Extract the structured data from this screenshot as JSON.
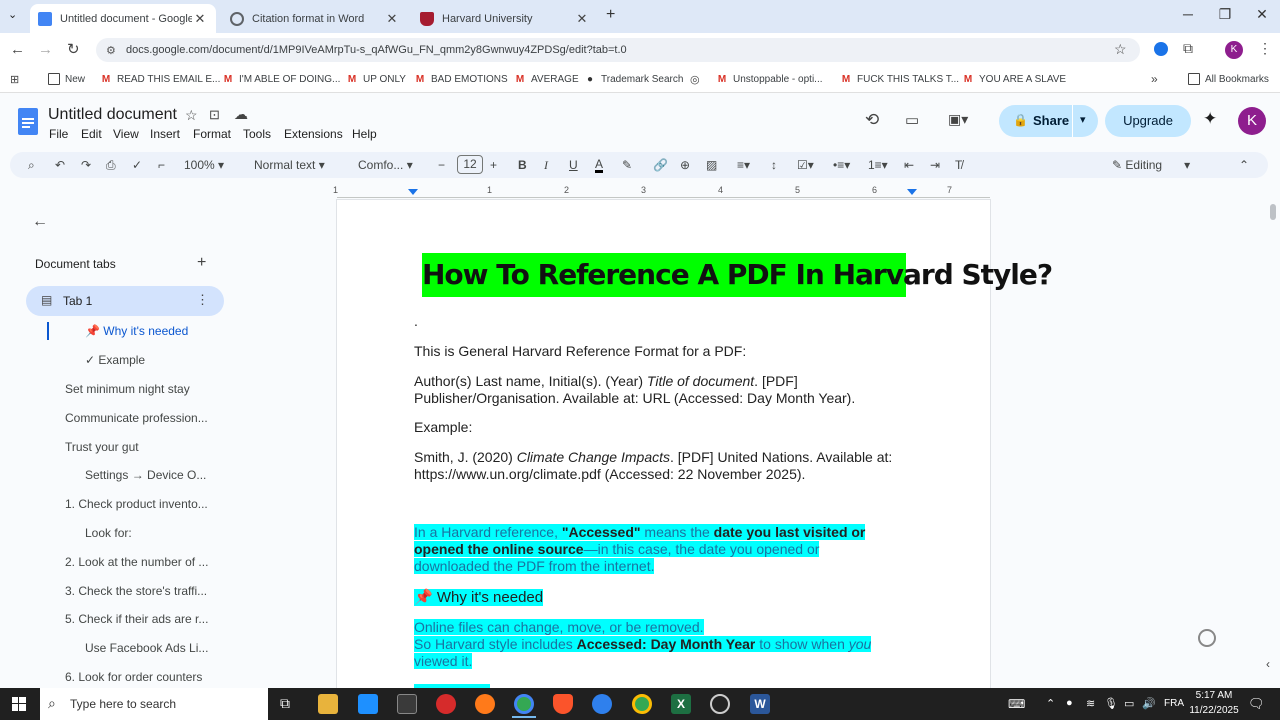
{
  "browser": {
    "tabs": [
      {
        "label": "Untitled document - Google Docs",
        "favicon_color": "#4285f4"
      },
      {
        "label": "Citation format in Word",
        "favicon_color": "#5f6368"
      },
      {
        "label": "Harvard University",
        "favicon_color": "#a51c30"
      }
    ],
    "url": "docs.google.com/document/d/1MP9IVeAMrpTu-s_qAfWGu_FN_qmm2y8Gwnwuy4ZPDSg/edit?tab=t.0",
    "profile_initial": "K"
  },
  "bookmarks": [
    {
      "label": "New",
      "icon": "folder-icon"
    },
    {
      "label": "READ THIS EMAIL E...",
      "icon": "gmail-icon"
    },
    {
      "label": "I'M ABLE OF DOING...",
      "icon": "gmail-icon"
    },
    {
      "label": "UP ONLY",
      "icon": "gmail-icon"
    },
    {
      "label": "BAD EMOTIONS",
      "icon": "gmail-icon"
    },
    {
      "label": "AVERAGE",
      "icon": "gmail-icon"
    },
    {
      "label": "Trademark Search",
      "icon": "pin-icon"
    },
    {
      "label": "Unstoppable - opti...",
      "icon": "gmail-icon"
    },
    {
      "label": "FUCK THIS TALKS T...",
      "icon": "gmail-icon"
    },
    {
      "label": "YOU ARE A SLAVE",
      "icon": "gmail-icon"
    },
    {
      "label": "All Bookmarks",
      "icon": "folder-icon"
    }
  ],
  "docs": {
    "title": "Untitled document",
    "menu": [
      "File",
      "Edit",
      "View",
      "Insert",
      "Format",
      "Tools",
      "Extensions",
      "Help"
    ],
    "share_label": "Share",
    "upgrade_label": "Upgrade",
    "user_initial": "K",
    "toolbar": {
      "zoom": "100%",
      "style": "Normal text",
      "font": "Comfo...",
      "font_size": "12",
      "mode": "Editing"
    },
    "ruler_labels": [
      "1",
      "1",
      "2",
      "3",
      "4",
      "5",
      "6",
      "7"
    ]
  },
  "sidebar": {
    "heading": "Document tabs",
    "tab_label": "Tab 1",
    "items": [
      {
        "label": "📌 Why it's needed",
        "active": true
      },
      {
        "label": "✓ Example",
        "active": false
      },
      {
        "label": "Set minimum night stay",
        "active": false
      },
      {
        "label": "Communicate profession...",
        "active": false
      },
      {
        "label": "Trust your gut",
        "active": false
      },
      {
        "label": "Settings → Device O...",
        "active": false
      },
      {
        "label": "1. Check product invento...",
        "active": false
      },
      {
        "label": "Look for:",
        "active": false
      },
      {
        "label": "2. Look at the number of ...",
        "active": false
      },
      {
        "label": "3. Check the store's traffi...",
        "active": false
      },
      {
        "label": "5. Check if their ads are r...",
        "active": false
      },
      {
        "label": "Use Facebook Ads Li...",
        "active": false
      },
      {
        "label": "6. Look for order counters",
        "active": false
      }
    ]
  },
  "document": {
    "heading": "How To Reference A PDF In Harvard Style?",
    "dot": ".",
    "intro": "This is General Harvard Reference Format for a PDF:",
    "format_line1_a": "Author(s) Last name, Initial(s). (Year) ",
    "format_line1_italic": "Title of document",
    "format_line1_b": ". [PDF]",
    "format_line2": "Publisher/Organisation. Available at: URL (Accessed: Day Month Year).",
    "example_label": "Example:",
    "example_line1_a": "Smith, J. (2020) ",
    "example_line1_italic": "Climate Change Impacts",
    "example_line1_b": ". [PDF] United Nations. Available at:",
    "example_line2": "https://www.un.org/climate.pdf (Accessed: 22 November 2025).",
    "note_p1": "In a Harvard reference, ",
    "note_b1": "\"Accessed\"",
    "note_p2": " means the ",
    "note_b2": "date you last visited or",
    "note_b3": "opened the online source",
    "note_p3": "—in this case, the date you opened or",
    "note_p4": "downloaded the PDF from the internet.",
    "why_heading": "📌 Why it's needed",
    "why_p1": "Online files can change, move, or be removed.",
    "why_p2a": " So Harvard style includes ",
    "why_b": "Accessed: Day Month Year",
    "why_p2b": " to show when ",
    "why_i": "you",
    "why_p3": "viewed it."
  },
  "taskbar": {
    "search_placeholder": "Type here to search",
    "language": "FRA",
    "time": "5:17 AM",
    "date": "11/22/2025"
  },
  "colors": {
    "heading_highlight": "#00ff00",
    "text_highlight": "#00ffff",
    "accent": "#0b57d0",
    "share_bg": "#c2e7ff",
    "avatar": "#8e1e8e"
  }
}
